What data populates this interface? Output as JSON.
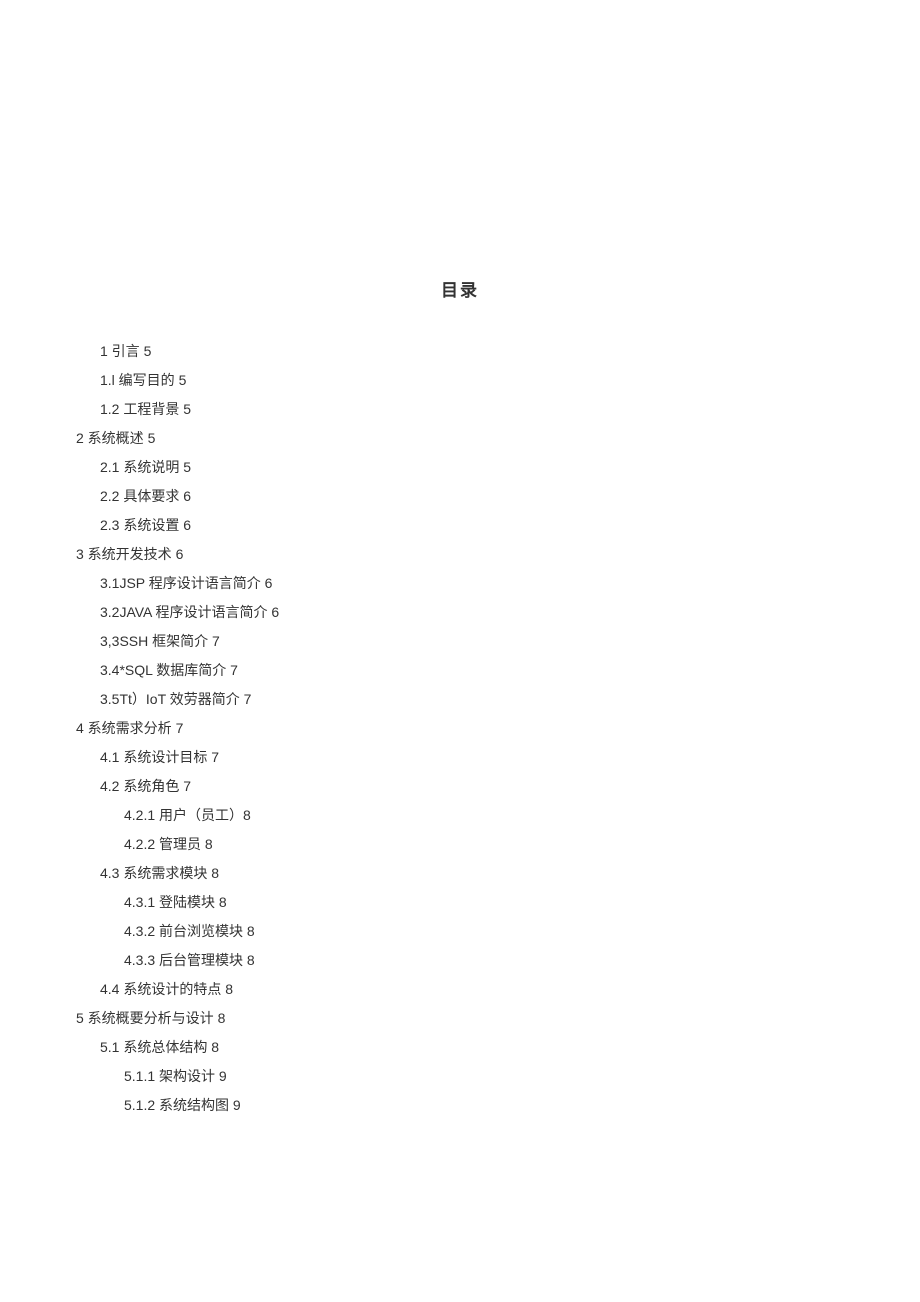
{
  "title": "目录",
  "toc": [
    {
      "level": 1,
      "text": "1 引言 5"
    },
    {
      "level": 1,
      "text": "1.l 编写目的 5"
    },
    {
      "level": 1,
      "text": "1.2 工程背景 5"
    },
    {
      "level": 0,
      "text": "2 系统概述 5"
    },
    {
      "level": 1,
      "text": "2.1 系统说明 5"
    },
    {
      "level": 1,
      "text": "2.2 具体要求 6"
    },
    {
      "level": 1,
      "text": "2.3 系统设置 6"
    },
    {
      "level": 0,
      "text": "3 系统开发技术 6"
    },
    {
      "level": 1,
      "text": "3.1JSP 程序设计语言简介 6"
    },
    {
      "level": 1,
      "text": "3.2JAVA 程序设计语言简介 6"
    },
    {
      "level": 1,
      "text": "3,3SSH 框架简介 7"
    },
    {
      "level": 1,
      "text": "3.4*SQL 数据库简介 7"
    },
    {
      "level": 1,
      "text": "3.5Tt）IoT 效劳器简介 7"
    },
    {
      "level": 0,
      "text": "4 系统需求分析 7"
    },
    {
      "level": 1,
      "text": "4.1 系统设计目标 7"
    },
    {
      "level": 1,
      "text": "4.2 系统角色 7"
    },
    {
      "level": 2,
      "text": "4.2.1 用户（员工）8"
    },
    {
      "level": 2,
      "text": "4.2.2 管理员 8"
    },
    {
      "level": 1,
      "text": "4.3 系统需求模块 8"
    },
    {
      "level": 2,
      "text": "4.3.1 登陆模块 8"
    },
    {
      "level": 2,
      "text": "4.3.2 前台浏览模块 8"
    },
    {
      "level": 2,
      "text": "4.3.3 后台管理模块 8"
    },
    {
      "level": 1,
      "text": "4.4 系统设计的特点 8"
    },
    {
      "level": 0,
      "text": "5 系统概要分析与设计 8"
    },
    {
      "level": 1,
      "text": "5.1 系统总体结构 8"
    },
    {
      "level": 2,
      "text": "5.1.1 架构设计 9"
    },
    {
      "level": 2,
      "text": "5.1.2 系统结构图 9"
    }
  ]
}
